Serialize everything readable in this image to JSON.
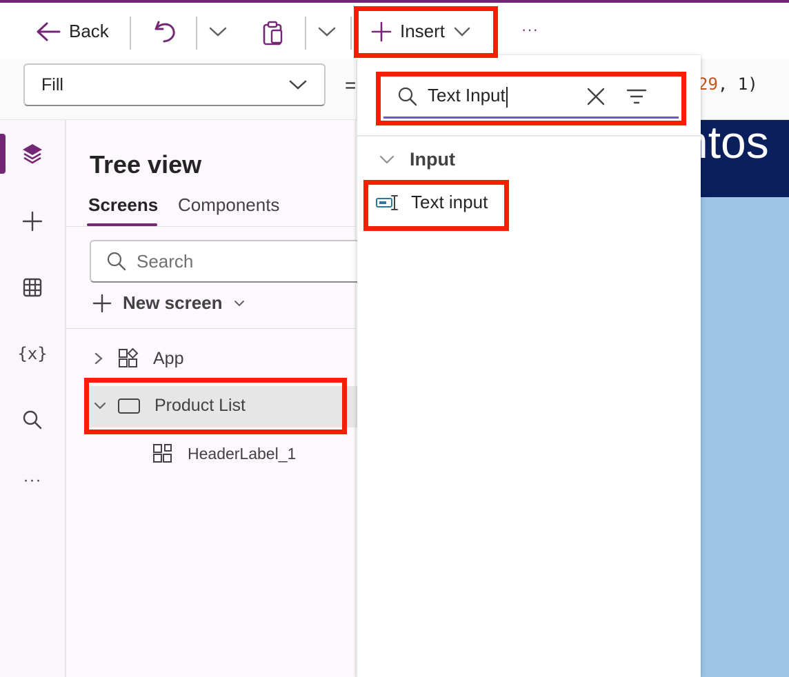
{
  "toolbar": {
    "back_label": "Back",
    "insert_label": "Insert",
    "more_label": "···"
  },
  "formula_bar": {
    "property": "Fill",
    "equals": "=",
    "formula_tail_num": "29",
    "formula_tail_rest": ", 1)"
  },
  "left_rail": {
    "items": [
      "tree-view",
      "insert",
      "data",
      "variables",
      "search",
      "more"
    ],
    "variables_label": "{x}",
    "more_label": "···"
  },
  "tree_view": {
    "title": "Tree view",
    "tabs": [
      {
        "label": "Screens",
        "selected": true
      },
      {
        "label": "Components",
        "selected": false
      }
    ],
    "search_placeholder": "Search",
    "new_screen_label": "New screen",
    "nodes": [
      {
        "label": "App",
        "expanded": false
      },
      {
        "label": "Product List",
        "expanded": true,
        "selected": true
      },
      {
        "label": "HeaderLabel_1"
      }
    ]
  },
  "canvas": {
    "header_fragment": "ntos",
    "header_color": "#0a1f5c",
    "body_color": "#9dc6e5"
  },
  "insert_flyout": {
    "search_value": "Text Input",
    "section_label": "Input",
    "item_label": "Text input"
  },
  "colors": {
    "accent": "#742774",
    "highlight": "#f91e00",
    "focus_underline": "#5b5fc7"
  }
}
